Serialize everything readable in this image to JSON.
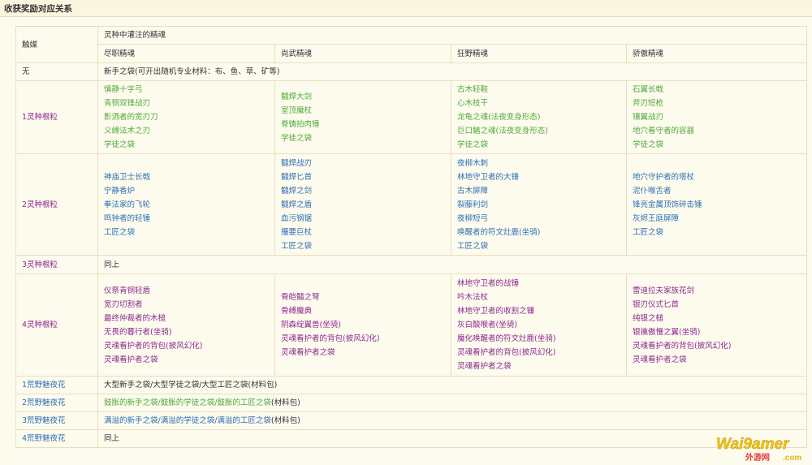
{
  "page": {
    "title": "收获奖励对应关系"
  },
  "table": {
    "h_catalyst": "触媒",
    "h_group": "灵种中灌注的精魂",
    "h_cols": [
      "尽职精魂",
      "尚武精魂",
      "狂野精魂",
      "骄傲精魂"
    ],
    "none_row": {
      "label": "无",
      "text": "新手之袋(可开出随机专业材料：布、鱼、草、矿等)"
    },
    "rows": [
      {
        "label": "1灵种根粒",
        "cols": [
          [
            "慎静十字弓",
            "青铜双锋战刃",
            "影洒者的宽刃刀",
            "义缚法术之刃",
            "学徒之袋"
          ],
          [
            "髓焊大剑",
            "室顶魔杖",
            "脊铸拍肉锤",
            "学徒之袋"
          ],
          [
            "古木轻鞋",
            "心木枝干",
            "龙龟之魂(法夜变身形态)",
            "巨口鳝之魂(法夜变身形态)",
            "学徒之袋"
          ],
          [
            "石翼长戟",
            "斧刃短枪",
            "镶翼战刃",
            "地穴看守者的容器",
            "学徒之袋"
          ]
        ]
      },
      {
        "label": "2灵种根粒",
        "cols": [
          [
            "神庙卫士长戟",
            "宁静香炉",
            "拳法家的飞轮",
            "鸣钟者的轻锤",
            "工匠之袋"
          ],
          [
            "髓焊战刃",
            "髓焊匕首",
            "髓焊之剑",
            "髓焊之盾",
            "血污钢锯",
            "攥要巨杖",
            "工匠之袋"
          ],
          [
            "夜柳木刺",
            "林地守卫者的大锤",
            "古木屏障",
            "裂藤利剑",
            "夜柳短弓",
            "唤醒者的符文灶鹿(坐骑)",
            "工匠之袋"
          ],
          [
            "地穴守护者的塔杖",
            "泥仆喉舌者",
            "锋亮金属顶饰碎击锤",
            "灰烬王庭屏障",
            "工匠之袋"
          ]
        ]
      },
      {
        "label": "3灵种根粒",
        "text": "同上"
      },
      {
        "label": "4灵种根粒",
        "cols": [
          [
            "仪祭青铜轻盾",
            "宽刃切割者",
            "最终仲裁者的木槌",
            "无畏的暮行者(坐骑)",
            "灵魂看护者的背包(披风幻化)",
            "灵魂看护者之袋"
          ],
          [
            "骨皑髓之弩",
            "骨缚魔典",
            "阴森绽翼兽(坐骑)",
            "灵魂看护者的背包(披风幻化)",
            "灵魂看护者之袋"
          ],
          [
            "林地守卫者的战锤",
            "吟木法杖",
            "林地守卫者的收割之镰",
            "灰白酸喉者(坐骑)",
            "魔化唤醒者的符文灶鹿(坐骑)",
            "灵魂看护者的背包(披风幻化)",
            "灵魂看护者之袋"
          ],
          [
            "雷迪拉夫家族花剑",
            "银刃仪式匕首",
            "纯银之槌",
            "银擒傲慢之翼(坐骑)",
            "灵魂看护者的背包(披风幻化)",
            "灵魂看护者之袋"
          ]
        ]
      }
    ],
    "flower_rows": [
      {
        "label": "1荒野魅夜花",
        "text": "大型新手之袋/大型学徒之袋/大型工匠之袋(材料包)"
      },
      {
        "label": "2荒野魅夜花",
        "text_colored": "鼓胀的新手之袋/鼓胀的学徒之袋/鼓胀的工匠之袋",
        "text_suffix": "(材料包)"
      },
      {
        "label": "3荒野魅夜花",
        "text_colored": "满溢的新手之袋/满溢的学徒之袋/满溢的工匠之袋",
        "text_suffix": "(材料包)"
      },
      {
        "label": "4荒野魅夜花",
        "text": "同上"
      }
    ]
  },
  "watermark": {
    "text": "Wai9amer",
    "sub": "外游网",
    "domain": ".com"
  }
}
